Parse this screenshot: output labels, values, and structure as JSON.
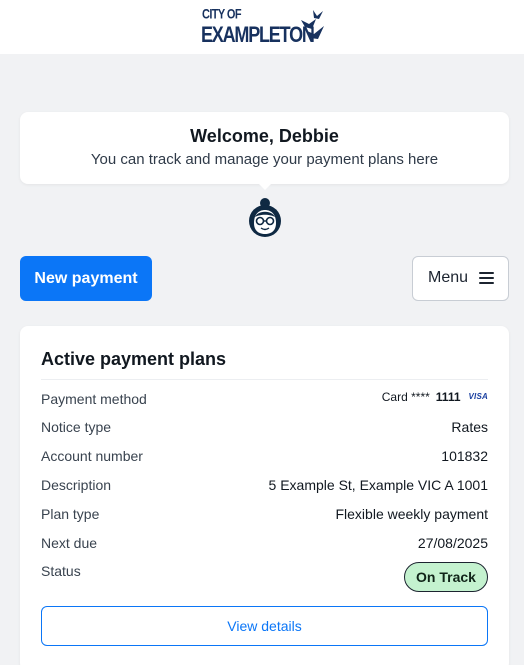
{
  "brand": {
    "logo_line1": "CITY OF",
    "logo_line2": "EXAMPLETON",
    "logo_color": "#17315e"
  },
  "welcome": {
    "title": "Welcome, Debbie",
    "subtitle": "You can track and manage your payment plans here"
  },
  "actions": {
    "new_payment_label": "New payment",
    "menu_label": "Menu",
    "primary_color": "#0b76f7"
  },
  "plans_card": {
    "title": "Active payment plans",
    "rows": [
      {
        "label": "Payment method",
        "value": "Card ****"
      },
      {
        "label": "Notice type",
        "value": "Rates"
      },
      {
        "label": "Account number",
        "value": "101832"
      },
      {
        "label": "Description",
        "value": "5 Example St, Example VIC A 1001"
      },
      {
        "label": "Plan type",
        "value": "Flexible weekly payment"
      },
      {
        "label": "Next due",
        "value": "27/08/2025"
      },
      {
        "label": "Status",
        "value": "On Track"
      }
    ],
    "card_last4": "1111",
    "card_brand": "VISA",
    "status_color": "#c4f2cf",
    "view_details_label": "View details"
  },
  "icons": [
    "city-logo-birds-icon",
    "user-avatar-icon",
    "hamburger-menu-icon",
    "visa-card-icon"
  ]
}
